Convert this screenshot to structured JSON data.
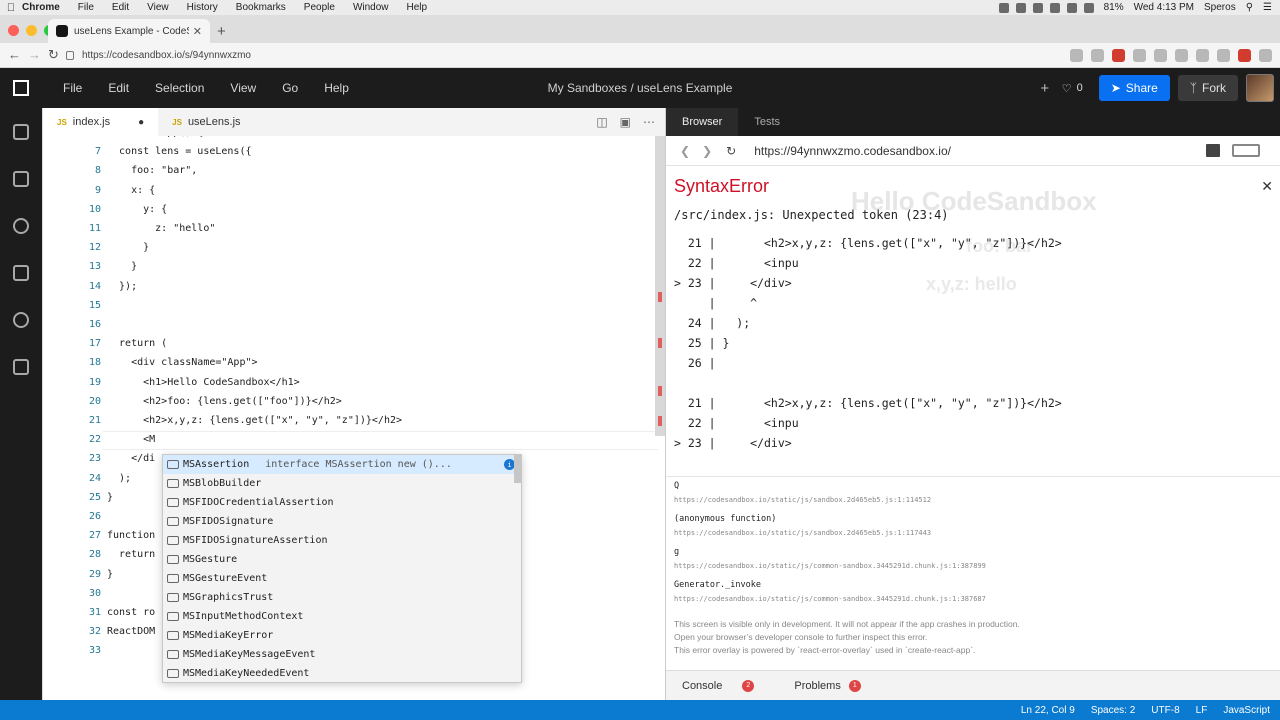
{
  "mac": {
    "app_name": "Chrome",
    "menu": [
      "File",
      "Edit",
      "View",
      "History",
      "Bookmarks",
      "People",
      "Window",
      "Help"
    ],
    "battery": "81%",
    "clock": "Wed 4:13 PM",
    "user": "Speros"
  },
  "browser": {
    "tab_title": "useLens Example - CodeSandbox",
    "url": "https://codesandbox.io/s/94ynnwxzmo"
  },
  "cs_header": {
    "menu": [
      "File",
      "Edit",
      "Selection",
      "View",
      "Go",
      "Help"
    ],
    "title": "My Sandboxes / useLens Example",
    "like_count": "0",
    "share_label": "Share",
    "fork_label": "Fork"
  },
  "editor": {
    "tabs": [
      {
        "label": "index.js",
        "modified": "●"
      },
      {
        "label": "useLens.js",
        "modified": ""
      }
    ],
    "lines": [
      {
        "n": "",
        "t": "function App() {"
      },
      {
        "n": "7",
        "t": "  const lens = useLens({"
      },
      {
        "n": "8",
        "t": "    foo: \"bar\","
      },
      {
        "n": "9",
        "t": "    x: {"
      },
      {
        "n": "10",
        "t": "      y: {"
      },
      {
        "n": "11",
        "t": "        z: \"hello\""
      },
      {
        "n": "12",
        "t": "      }"
      },
      {
        "n": "13",
        "t": "    }"
      },
      {
        "n": "14",
        "t": "  });"
      },
      {
        "n": "15",
        "t": ""
      },
      {
        "n": "16",
        "t": ""
      },
      {
        "n": "17",
        "t": "  return ("
      },
      {
        "n": "18",
        "t": "    <div className=\"App\">"
      },
      {
        "n": "19",
        "t": "      <h1>Hello CodeSandbox</h1>"
      },
      {
        "n": "20",
        "t": "      <h2>foo: {lens.get([\"foo\"])}</h2>"
      },
      {
        "n": "21",
        "t": "      <h2>x,y,z: {lens.get([\"x\", \"y\", \"z\"])}</h2>"
      },
      {
        "n": "22",
        "t": "      <M"
      },
      {
        "n": "23",
        "t": "    </di"
      },
      {
        "n": "24",
        "t": "  );"
      },
      {
        "n": "25",
        "t": "}"
      },
      {
        "n": "26",
        "t": ""
      },
      {
        "n": "27",
        "t": "function"
      },
      {
        "n": "28",
        "t": "  return"
      },
      {
        "n": "29",
        "t": "}"
      },
      {
        "n": "30",
        "t": ""
      },
      {
        "n": "31",
        "t": "const ro"
      },
      {
        "n": "32",
        "t": "ReactDOM"
      },
      {
        "n": "33",
        "t": ""
      }
    ],
    "suggestions": [
      {
        "label": "MSAssertion",
        "detail": "interface MSAssertion new ()..."
      },
      {
        "label": "MSBlobBuilder",
        "detail": ""
      },
      {
        "label": "MSFIDOCredentialAssertion",
        "detail": ""
      },
      {
        "label": "MSFIDOSignature",
        "detail": ""
      },
      {
        "label": "MSFIDOSignatureAssertion",
        "detail": ""
      },
      {
        "label": "MSGesture",
        "detail": ""
      },
      {
        "label": "MSGestureEvent",
        "detail": ""
      },
      {
        "label": "MSGraphicsTrust",
        "detail": ""
      },
      {
        "label": "MSInputMethodContext",
        "detail": ""
      },
      {
        "label": "MSMediaKeyError",
        "detail": ""
      },
      {
        "label": "MSMediaKeyMessageEvent",
        "detail": ""
      },
      {
        "label": "MSMediaKeyNeededEvent",
        "detail": ""
      }
    ]
  },
  "panel": {
    "tabs": [
      "Browser",
      "Tests"
    ],
    "url": "https://94ynnwxzmo.codesandbox.io/",
    "preview_ghost": {
      "h1": "Hello CodeSandbox",
      "h2a": "foo: bar",
      "h2b": "x,y,z: hello"
    },
    "error": {
      "title": "SyntaxError",
      "message": "/src/index.js: Unexpected token (23:4)",
      "frame1": [
        "  21 |       <h2>x,y,z: {lens.get([\"x\", \"y\", \"z\"])}</h2>",
        "  22 |       <inpu",
        "> 23 |     </div>",
        "     |     ^",
        "  24 |   );",
        "  25 | }",
        "  26 |"
      ],
      "frame2": [
        "  21 |       <h2>x,y,z: {lens.get([\"x\", \"y\", \"z\"])}</h2>",
        "  22 |       <inpu",
        "> 23 |     </div>"
      ],
      "stack": [
        {
          "fn": "Q",
          "link": "https://codesandbox.io/static/js/sandbox.2d465eb5.js:1:114512"
        },
        {
          "fn": "(anonymous function)",
          "link": "https://codesandbox.io/static/js/sandbox.2d465eb5.js:1:117443"
        },
        {
          "fn": "g",
          "link": "https://codesandbox.io/static/js/common-sandbox.3445291d.chunk.js:1:387899"
        },
        {
          "fn": "Generator._invoke",
          "link": "https://codesandbox.io/static/js/common-sandbox.3445291d.chunk.js:1:387687"
        }
      ],
      "footer": [
        "This screen is visible only in development. It will not appear if the app crashes in production.",
        "Open your browser’s developer console to further inspect this error.",
        "This error overlay is powered by `react-error-overlay` used in `create-react-app`."
      ]
    },
    "bottom_tabs": [
      {
        "label": "Console",
        "count": "2"
      },
      {
        "label": "Problems",
        "count": "1"
      }
    ]
  },
  "status": {
    "position": "Ln 22, Col 9",
    "spaces": "Spaces: 2",
    "encoding": "UTF-8",
    "eol": "LF",
    "language": "JavaScript"
  }
}
